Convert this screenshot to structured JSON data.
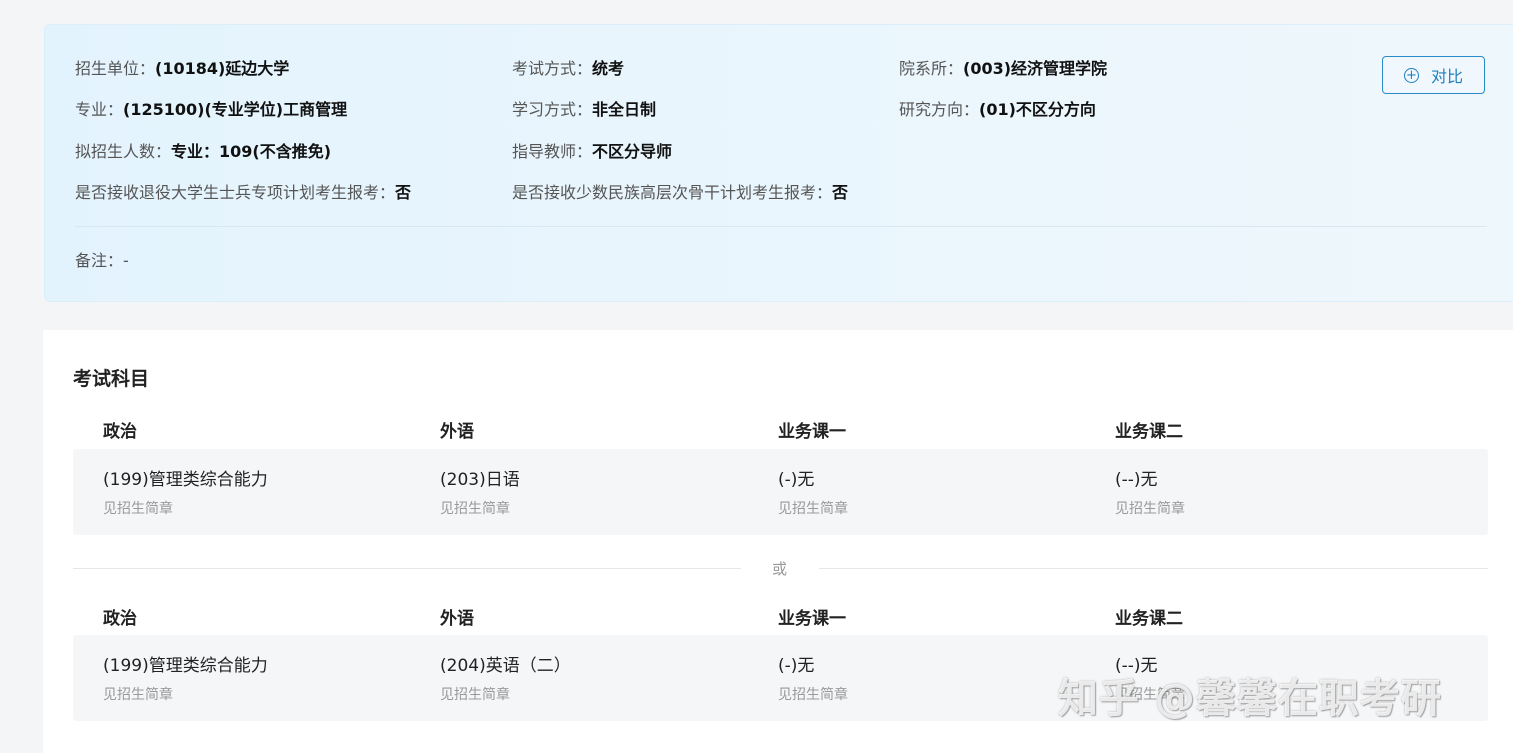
{
  "info": {
    "unit_label": "招生单位：",
    "unit_value": "(10184)延边大学",
    "exam_mode_label": "考试方式：",
    "exam_mode_value": "统考",
    "department_label": "院系所：",
    "department_value": "(003)经济管理学院",
    "major_label": "专业：",
    "major_value": "(125100)(专业学位)工商管理",
    "study_mode_label": "学习方式：",
    "study_mode_value": "非全日制",
    "direction_label": "研究方向：",
    "direction_value": "(01)不区分方向",
    "quota_label": "拟招生人数：",
    "quota_value": "专业：109(不含推免)",
    "advisor_label": "指导教师：",
    "advisor_value": "不区分导师",
    "veteran_label": "是否接收退役大学生士兵专项计划考生报考：",
    "veteran_value": "否",
    "minority_label": "是否接收少数民族高层次骨干计划考生报考：",
    "minority_value": "否",
    "remark_label": "备注：",
    "remark_value": "-",
    "compare_label": "对比"
  },
  "exam": {
    "title": "考试科目",
    "headers": [
      "政治",
      "外语",
      "业务课一",
      "业务课二"
    ],
    "or_label": "或",
    "options": [
      {
        "subjects": [
          {
            "main": "(199)管理类综合能力",
            "sub": "见招生简章"
          },
          {
            "main": "(203)日语",
            "sub": "见招生简章"
          },
          {
            "main": "(-)无",
            "sub": "见招生简章"
          },
          {
            "main": "(--)无",
            "sub": "见招生简章"
          }
        ]
      },
      {
        "subjects": [
          {
            "main": "(199)管理类综合能力",
            "sub": "见招生简章"
          },
          {
            "main": "(204)英语（二）",
            "sub": "见招生简章"
          },
          {
            "main": "(-)无",
            "sub": "见招生简章"
          },
          {
            "main": "(--)无",
            "sub": "见招生简章"
          }
        ]
      }
    ]
  },
  "watermark": "知乎 @馨馨在职考研"
}
